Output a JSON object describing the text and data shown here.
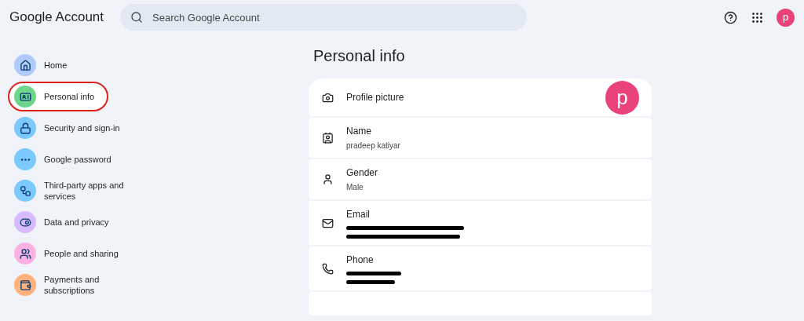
{
  "header": {
    "logo": "Google Account",
    "search": {
      "placeholder": "Search Google Account"
    },
    "avatar": "p"
  },
  "sidebar": {
    "items": [
      {
        "kind": "home",
        "label": "Home",
        "selected": false,
        "circled": false,
        "color": "#aecbfa"
      },
      {
        "kind": "badge",
        "label": "Personal info",
        "selected": true,
        "circled": true,
        "color": "#6dd58c"
      },
      {
        "kind": "lock",
        "label": "Security and sign-in",
        "selected": false,
        "circled": false,
        "color": "#7cc9ff"
      },
      {
        "kind": "password",
        "label": "Google password",
        "selected": false,
        "circled": false,
        "color": "#7cc9ff"
      },
      {
        "kind": "apps",
        "label": "Third-party apps and services",
        "selected": false,
        "circled": false,
        "color": "#7cc9ff"
      },
      {
        "kind": "toggle",
        "label": "Data and privacy",
        "selected": false,
        "circled": false,
        "color": "#d7bbff"
      },
      {
        "kind": "people",
        "label": "People and sharing",
        "selected": false,
        "circled": false,
        "color": "#fcb1e3"
      },
      {
        "kind": "card",
        "label": "Payments and subscriptions",
        "selected": false,
        "circled": false,
        "color": "#ffb27e"
      }
    ]
  },
  "main": {
    "title": "Personal info",
    "rows": [
      {
        "kind": "photo",
        "label": "Profile picture",
        "avatar": "p"
      },
      {
        "kind": "name",
        "label": "Name",
        "value": "pradeep katiyar"
      },
      {
        "kind": "gender",
        "label": "Gender",
        "value": "Male"
      },
      {
        "kind": "email",
        "label": "Email",
        "redacted": true
      },
      {
        "kind": "phone",
        "label": "Phone",
        "redacted": true
      }
    ]
  }
}
